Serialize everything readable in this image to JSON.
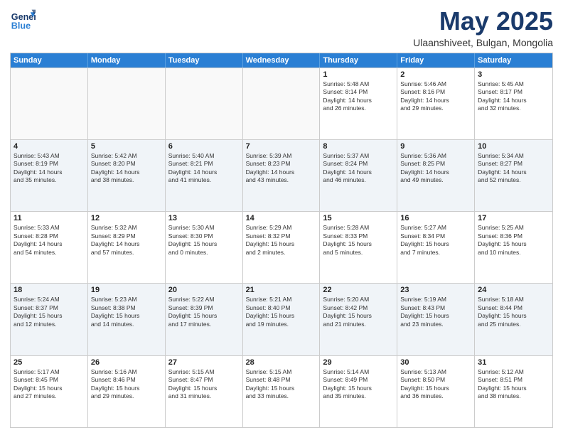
{
  "logo": {
    "line1": "General",
    "line2": "Blue"
  },
  "title": "May 2025",
  "subtitle": "Ulaanshiveet, Bulgan, Mongolia",
  "header_days": [
    "Sunday",
    "Monday",
    "Tuesday",
    "Wednesday",
    "Thursday",
    "Friday",
    "Saturday"
  ],
  "rows": [
    [
      {
        "day": "",
        "info": "",
        "empty": true
      },
      {
        "day": "",
        "info": "",
        "empty": true
      },
      {
        "day": "",
        "info": "",
        "empty": true
      },
      {
        "day": "",
        "info": "",
        "empty": true
      },
      {
        "day": "1",
        "info": "Sunrise: 5:48 AM\nSunset: 8:14 PM\nDaylight: 14 hours\nand 26 minutes."
      },
      {
        "day": "2",
        "info": "Sunrise: 5:46 AM\nSunset: 8:16 PM\nDaylight: 14 hours\nand 29 minutes."
      },
      {
        "day": "3",
        "info": "Sunrise: 5:45 AM\nSunset: 8:17 PM\nDaylight: 14 hours\nand 32 minutes."
      }
    ],
    [
      {
        "day": "4",
        "info": "Sunrise: 5:43 AM\nSunset: 8:19 PM\nDaylight: 14 hours\nand 35 minutes."
      },
      {
        "day": "5",
        "info": "Sunrise: 5:42 AM\nSunset: 8:20 PM\nDaylight: 14 hours\nand 38 minutes."
      },
      {
        "day": "6",
        "info": "Sunrise: 5:40 AM\nSunset: 8:21 PM\nDaylight: 14 hours\nand 41 minutes."
      },
      {
        "day": "7",
        "info": "Sunrise: 5:39 AM\nSunset: 8:23 PM\nDaylight: 14 hours\nand 43 minutes."
      },
      {
        "day": "8",
        "info": "Sunrise: 5:37 AM\nSunset: 8:24 PM\nDaylight: 14 hours\nand 46 minutes."
      },
      {
        "day": "9",
        "info": "Sunrise: 5:36 AM\nSunset: 8:25 PM\nDaylight: 14 hours\nand 49 minutes."
      },
      {
        "day": "10",
        "info": "Sunrise: 5:34 AM\nSunset: 8:27 PM\nDaylight: 14 hours\nand 52 minutes."
      }
    ],
    [
      {
        "day": "11",
        "info": "Sunrise: 5:33 AM\nSunset: 8:28 PM\nDaylight: 14 hours\nand 54 minutes."
      },
      {
        "day": "12",
        "info": "Sunrise: 5:32 AM\nSunset: 8:29 PM\nDaylight: 14 hours\nand 57 minutes."
      },
      {
        "day": "13",
        "info": "Sunrise: 5:30 AM\nSunset: 8:30 PM\nDaylight: 15 hours\nand 0 minutes."
      },
      {
        "day": "14",
        "info": "Sunrise: 5:29 AM\nSunset: 8:32 PM\nDaylight: 15 hours\nand 2 minutes."
      },
      {
        "day": "15",
        "info": "Sunrise: 5:28 AM\nSunset: 8:33 PM\nDaylight: 15 hours\nand 5 minutes."
      },
      {
        "day": "16",
        "info": "Sunrise: 5:27 AM\nSunset: 8:34 PM\nDaylight: 15 hours\nand 7 minutes."
      },
      {
        "day": "17",
        "info": "Sunrise: 5:25 AM\nSunset: 8:36 PM\nDaylight: 15 hours\nand 10 minutes."
      }
    ],
    [
      {
        "day": "18",
        "info": "Sunrise: 5:24 AM\nSunset: 8:37 PM\nDaylight: 15 hours\nand 12 minutes."
      },
      {
        "day": "19",
        "info": "Sunrise: 5:23 AM\nSunset: 8:38 PM\nDaylight: 15 hours\nand 14 minutes."
      },
      {
        "day": "20",
        "info": "Sunrise: 5:22 AM\nSunset: 8:39 PM\nDaylight: 15 hours\nand 17 minutes."
      },
      {
        "day": "21",
        "info": "Sunrise: 5:21 AM\nSunset: 8:40 PM\nDaylight: 15 hours\nand 19 minutes."
      },
      {
        "day": "22",
        "info": "Sunrise: 5:20 AM\nSunset: 8:42 PM\nDaylight: 15 hours\nand 21 minutes."
      },
      {
        "day": "23",
        "info": "Sunrise: 5:19 AM\nSunset: 8:43 PM\nDaylight: 15 hours\nand 23 minutes."
      },
      {
        "day": "24",
        "info": "Sunrise: 5:18 AM\nSunset: 8:44 PM\nDaylight: 15 hours\nand 25 minutes."
      }
    ],
    [
      {
        "day": "25",
        "info": "Sunrise: 5:17 AM\nSunset: 8:45 PM\nDaylight: 15 hours\nand 27 minutes."
      },
      {
        "day": "26",
        "info": "Sunrise: 5:16 AM\nSunset: 8:46 PM\nDaylight: 15 hours\nand 29 minutes."
      },
      {
        "day": "27",
        "info": "Sunrise: 5:15 AM\nSunset: 8:47 PM\nDaylight: 15 hours\nand 31 minutes."
      },
      {
        "day": "28",
        "info": "Sunrise: 5:15 AM\nSunset: 8:48 PM\nDaylight: 15 hours\nand 33 minutes."
      },
      {
        "day": "29",
        "info": "Sunrise: 5:14 AM\nSunset: 8:49 PM\nDaylight: 15 hours\nand 35 minutes."
      },
      {
        "day": "30",
        "info": "Sunrise: 5:13 AM\nSunset: 8:50 PM\nDaylight: 15 hours\nand 36 minutes."
      },
      {
        "day": "31",
        "info": "Sunrise: 5:12 AM\nSunset: 8:51 PM\nDaylight: 15 hours\nand 38 minutes."
      }
    ]
  ],
  "alt_rows": [
    1,
    3
  ]
}
